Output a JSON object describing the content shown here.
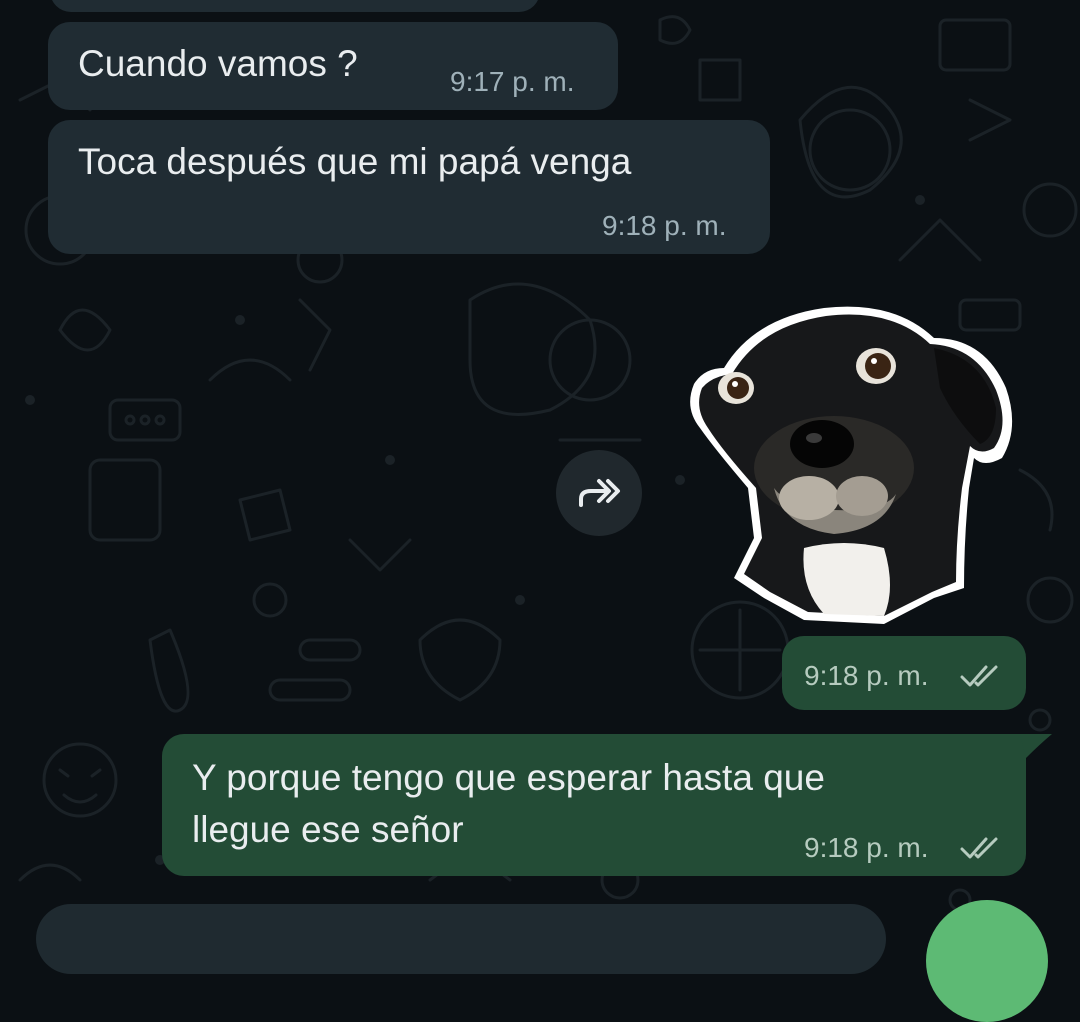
{
  "chat": {
    "messages": [
      {
        "type": "incoming",
        "text": "Cuando vamos ?",
        "time": "9:17 p. m."
      },
      {
        "type": "incoming",
        "text": "Toca después que mi papá venga",
        "time": "9:18 p. m."
      },
      {
        "type": "outgoing-sticker",
        "sticker": "black-dog-sticker",
        "time": "9:18 p. m.",
        "status": "delivered"
      },
      {
        "type": "outgoing",
        "lines": [
          "Y porque tengo que esperar hasta que",
          "llegue ese señor"
        ],
        "time": "9:18 p. m.",
        "status": "delivered"
      }
    ]
  },
  "icons": {
    "forward": "forward-icon",
    "ticks": "double-check-icon"
  },
  "colors": {
    "background": "#0b1014",
    "incoming_bubble": "#202c33",
    "outgoing_bubble": "#234c36",
    "fab": "#5dba74"
  }
}
